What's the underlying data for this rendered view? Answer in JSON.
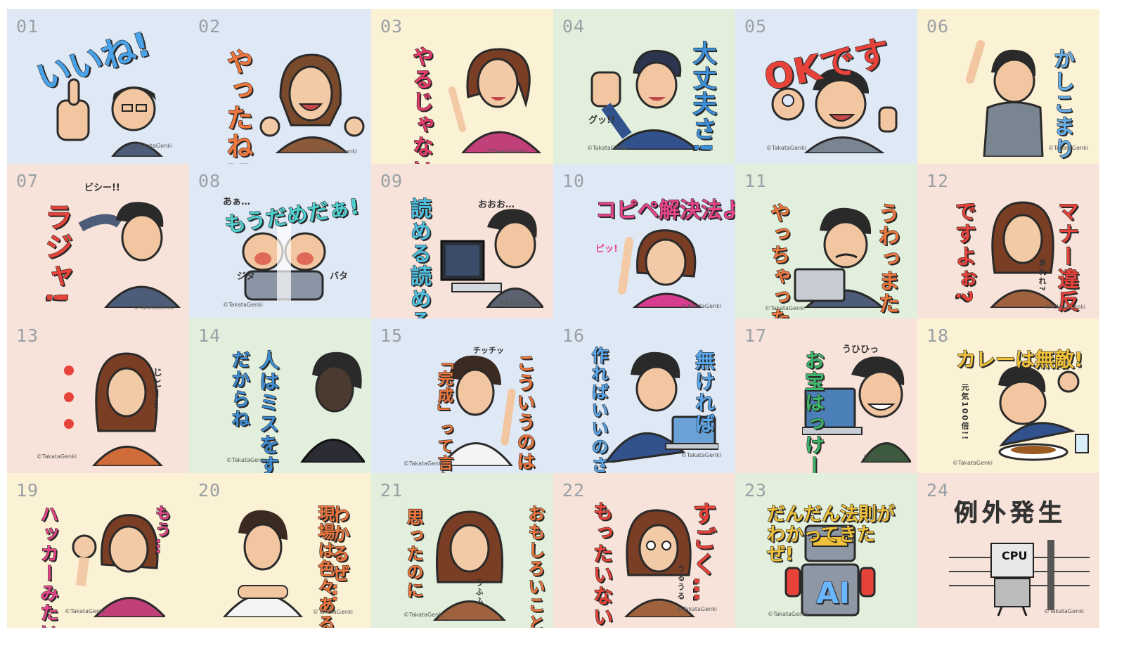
{
  "colors": {
    "blue": "#dfe8f5",
    "yellow": "#fbf1d4",
    "green": "#e2efdc",
    "peach": "#f7e3d9",
    "beige": "#f5e9db"
  },
  "cells": [
    {
      "num": "01",
      "caption": "いいね!",
      "credit": "©TakataGenki"
    },
    {
      "num": "02",
      "caption": "やったね!",
      "credit": "©TakataGenki"
    },
    {
      "num": "03",
      "caption": "やるじゃない",
      "credit": "©TakataGenki"
    },
    {
      "num": "04",
      "caption": "大丈夫さ!",
      "sub": "グッ!!",
      "credit": "©TakataGenki"
    },
    {
      "num": "05",
      "caption": "OKです",
      "credit": "©TakataGenki"
    },
    {
      "num": "06",
      "caption": "かしこまり",
      "credit": "©TakataGenki"
    },
    {
      "num": "07",
      "caption": "ラジャ!",
      "sub": "ビシー!!",
      "credit": "©TakataGenki"
    },
    {
      "num": "08",
      "caption": "もうだめだぁ!",
      "sub": "あぁ…",
      "sub2": "ジタ",
      "sub3": "バタ",
      "credit": "©TakataGenki"
    },
    {
      "num": "09",
      "caption": "読める読めるぞ…!",
      "sub": "おおお…",
      "credit": "©TakataGenki"
    },
    {
      "num": "10",
      "caption": "コピペ解決法よ!",
      "sub": "ピッ!",
      "credit": "©TakataGenki"
    },
    {
      "num": "11",
      "caption": "うわっまた",
      "caption2": "やっちゃったよ",
      "credit": "©TakataGenki"
    },
    {
      "num": "12",
      "caption": "マナー違反",
      "caption2": "ですよぉ?",
      "sub": "あれれ?",
      "credit": "©TakataGenki"
    },
    {
      "num": "13",
      "sub": "じとー…",
      "credit": "©TakataGenki"
    },
    {
      "num": "14",
      "caption": "人はミスをする生き物",
      "caption2": "だからね",
      "credit": "©TakataGenki"
    },
    {
      "num": "15",
      "caption": "こういうのは",
      "caption2": "「完成」って言わないんだ",
      "sub": "チッチッ",
      "credit": "©TakataGenki"
    },
    {
      "num": "16",
      "caption": "無ければ",
      "caption2": "作ればいいのさ",
      "credit": "©TakataGenki"
    },
    {
      "num": "17",
      "caption": "お宝はっけーん",
      "sub": "うひひっ",
      "credit": "©TakataGenki"
    },
    {
      "num": "18",
      "caption": "カレーは無敵!",
      "sub": "元気100倍!!",
      "credit": "©TakataGenki"
    },
    {
      "num": "19",
      "caption": "もう…",
      "caption2": "ハッカーみたいな子ね",
      "credit": "©TakataGenki"
    },
    {
      "num": "20",
      "caption": "わかるぜ…",
      "caption2": "現場は色々あるよな",
      "credit": "©TakataGenki"
    },
    {
      "num": "21",
      "caption": "おもしろいことになると",
      "caption2": "思ったのに",
      "sub": "うふふ",
      "credit": "©TakataGenki"
    },
    {
      "num": "22",
      "caption": "すごく…",
      "caption2": "もったいない!",
      "sub": "うるうる",
      "credit": "©TakataGenki"
    },
    {
      "num": "23",
      "caption": "だんだん法則がわかってきたぜ!",
      "sub": "AI",
      "credit": "©TakataGenki"
    },
    {
      "num": "24",
      "caption": "例外発生",
      "sub": "CPU",
      "credit": "©TakataGenki"
    }
  ]
}
